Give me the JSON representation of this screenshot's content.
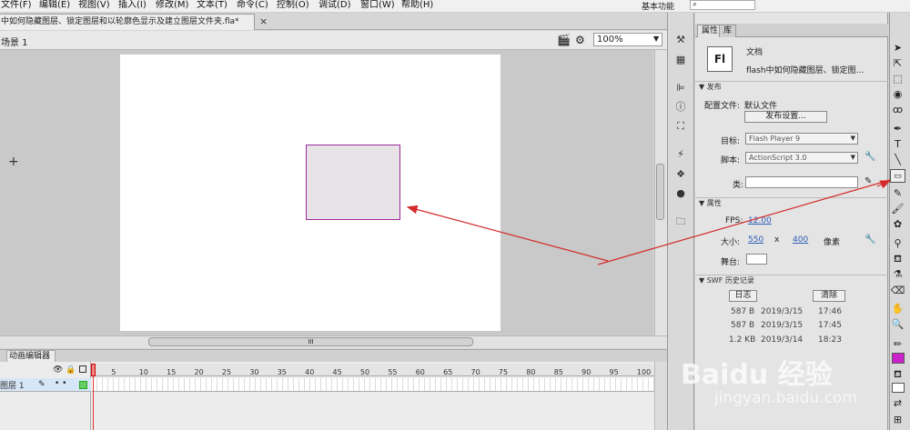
{
  "menubar": {
    "items": [
      "文件(F)",
      "编辑(E)",
      "视图(V)",
      "插入(I)",
      "修改(M)",
      "文本(T)",
      "命令(C)",
      "控制(O)",
      "调试(D)",
      "窗口(W)",
      "帮助(H)"
    ],
    "workspace": "基本功能",
    "search_icon": "search-icon"
  },
  "document": {
    "tab_title": "中如何隐藏图层、锁定图层和以轮廓色显示及建立图层文件夹.fla*",
    "close": "×",
    "scene": "场景 1",
    "zoom": "100%"
  },
  "stage": {
    "rect_fill": "#e7e3e6",
    "rect_stroke": "#9b2b9b",
    "crosshair": "+",
    "hscroll_grip": "III"
  },
  "timeline": {
    "tab_label": "动画编辑器",
    "frame_labels": [
      "1",
      "5",
      "10",
      "15",
      "20",
      "25",
      "30",
      "35",
      "40",
      "45",
      "50",
      "55",
      "60",
      "65",
      "70",
      "75",
      "80",
      "85",
      "90",
      "95",
      "100"
    ],
    "layer_name": "图层 1",
    "layer_dots": "•  •"
  },
  "properties": {
    "tab_properties": "属性",
    "tab_library": "库",
    "logo": "Fl",
    "doc_type": "文档",
    "doc_name": "flash中如何隐藏图层、锁定图...",
    "section_publish": "发布",
    "profile_label": "配置文件:",
    "profile_value": "默认文件",
    "publish_settings": "发布设置...",
    "target_label": "目标:",
    "target_value": "Flash Player 9",
    "script_label": "脚本:",
    "script_value": "ActionScript 3.0",
    "class_label": "类:",
    "section_props": "属性",
    "fps_label": "FPS:",
    "fps_value": "12.00",
    "size_label": "大小:",
    "width": "550",
    "x": "x",
    "height": "400",
    "unit": "像素",
    "stage_label": "舞台:",
    "section_swf": "SWF 历史记录",
    "log_button": "日志",
    "clear_button": "清除",
    "history": [
      {
        "size": "587 B",
        "date": "2019/3/15",
        "time": "17:46"
      },
      {
        "size": "587 B",
        "date": "2019/3/15",
        "time": "17:45"
      },
      {
        "size": "1.2 KB",
        "date": "2019/3/14",
        "time": "18:23"
      }
    ]
  },
  "watermark": {
    "brand": "Baidu 经验",
    "url": "jingyan.baidu.com"
  },
  "colors": {
    "annotation_arrow": "#d42a2a",
    "fill_swatch": "#cc22cc"
  }
}
